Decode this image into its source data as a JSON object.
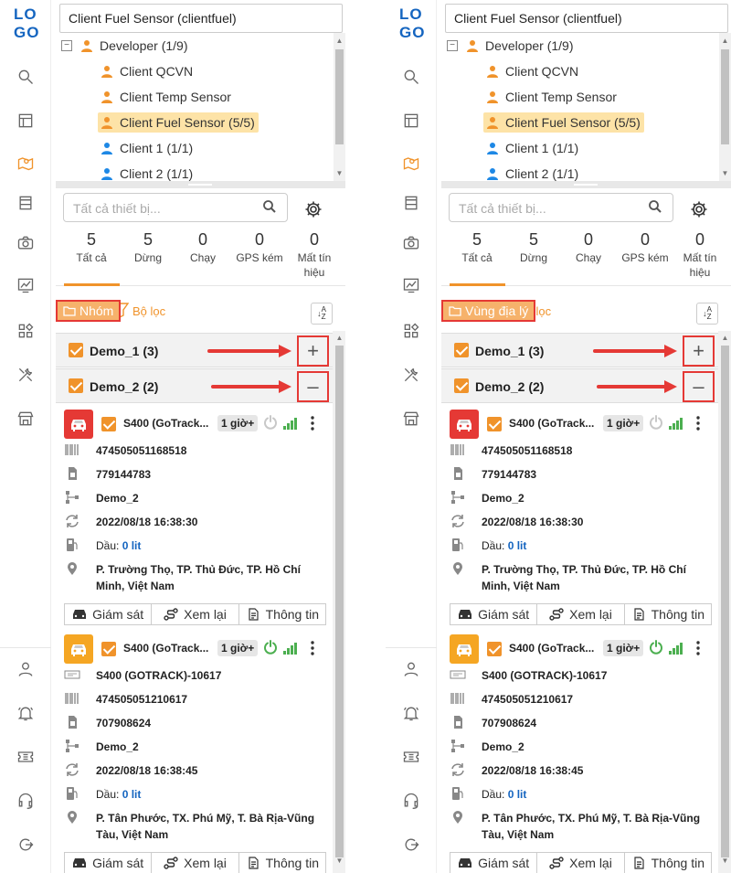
{
  "panels": [
    {
      "id": "panel-0",
      "top_select": "Client Fuel Sensor (clientfuel)",
      "tree": {
        "root": "Developer (1/9)",
        "children": [
          "Client QCVN",
          "Client Temp Sensor",
          "Client Fuel Sensor (5/5)",
          "Client 1 (1/1)",
          "Client 2 (1/1)"
        ],
        "selected_index": 2
      },
      "search_placeholder": "Tất cả thiết bị...",
      "stats": [
        {
          "value": "5",
          "label": "Tất cả"
        },
        {
          "value": "5",
          "label": "Dừng"
        },
        {
          "value": "0",
          "label": "Chạy"
        },
        {
          "value": "0",
          "label": "GPS kém"
        },
        {
          "value": "0",
          "label": "Mất tín hiệu"
        }
      ],
      "filter_label": "Bộ lọc",
      "group_button": "Nhóm",
      "groups": [
        {
          "title": "Demo_1 (3)",
          "toggle": "+"
        },
        {
          "title": "Demo_2 (2)",
          "toggle": "–"
        }
      ]
    },
    {
      "id": "panel-1",
      "top_select": "Client Fuel Sensor (clientfuel)",
      "tree": {
        "root": "Developer (1/9)",
        "children": [
          "Client QCVN",
          "Client Temp Sensor",
          "Client Fuel Sensor (5/5)",
          "Client 1 (1/1)",
          "Client 2 (1/1)"
        ],
        "selected_index": 2
      },
      "search_placeholder": "Tất cả thiết bị...",
      "stats": [
        {
          "value": "5",
          "label": "Tất cả"
        },
        {
          "value": "5",
          "label": "Dừng"
        },
        {
          "value": "0",
          "label": "Chạy"
        },
        {
          "value": "0",
          "label": "GPS kém"
        },
        {
          "value": "0",
          "label": "Mất tín hiệu"
        }
      ],
      "filter_label": "Bộ lọc",
      "group_button": "Vùng địa lý",
      "groups": [
        {
          "title": "Demo_1 (3)",
          "toggle": "+"
        },
        {
          "title": "Demo_2 (2)",
          "toggle": "–"
        }
      ]
    }
  ],
  "logo": [
    "LO",
    "GO"
  ],
  "devices": [
    {
      "car_color": "#e53935",
      "name": "S400 (GoTrack...",
      "badge": "1 giờ+",
      "power_color": "#c8c8c8",
      "rows": {
        "imei": "474505051168518",
        "sim": "779144783",
        "group": "Demo_2",
        "time": "2022/08/18 16:38:30",
        "fuel_label": "Dầu:",
        "fuel_value": "0 lit",
        "address": "P. Trường Thọ, TP. Thủ Đức, TP. Hồ Chí Minh, Việt Nam"
      }
    },
    {
      "car_color": "#f5a623",
      "name": "S400 (GoTrack...",
      "badge": "1 giờ+",
      "power_color": "#4caf50",
      "rows": {
        "plate": "S400 (GOTRACK)-10617",
        "imei": "474505051210617",
        "sim": "707908624",
        "group": "Demo_2",
        "time": "2022/08/18 16:38:45",
        "fuel_label": "Dầu:",
        "fuel_value": "0 lit",
        "address": "P. Tân Phước, TX. Phú Mỹ, T. Bà Rịa-Vũng Tàu, Việt Nam"
      }
    }
  ],
  "actions": [
    "Giám sát",
    "Xem lại",
    "Thông tin"
  ],
  "colors": {
    "accent": "#f0932b",
    "highlight": "#e53935",
    "link": "#1565c0"
  }
}
